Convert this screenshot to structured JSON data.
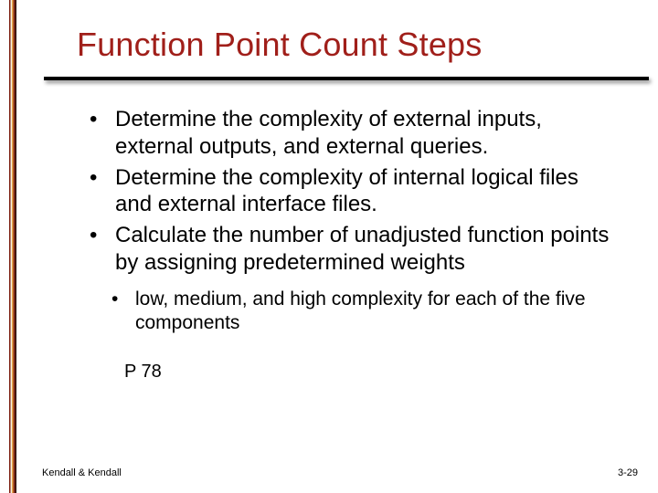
{
  "title": "Function Point Count Steps",
  "bullets": [
    "Determine the complexity of external inputs, external outputs, and external queries.",
    "Determine the complexity of internal logical files and external interface files.",
    "Calculate the number of unadjusted function points by assigning predetermined weights"
  ],
  "sub_bullets": [
    "low, medium, and high complexity for each of the five components"
  ],
  "page_ref": "P 78",
  "footer": {
    "left": "Kendall & Kendall",
    "right": "3-29"
  }
}
